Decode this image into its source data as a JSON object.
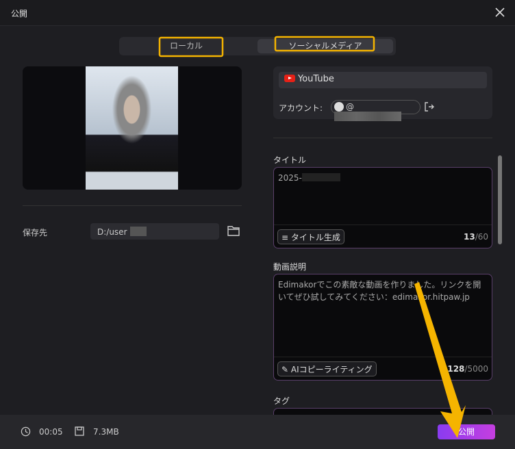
{
  "window": {
    "title": "公開"
  },
  "tabs": [
    {
      "label": "ローカル"
    },
    {
      "label": "ソーシャルメディア"
    }
  ],
  "save": {
    "label": "保存先",
    "path": "D:/user"
  },
  "platform": {
    "name": "YouTube",
    "account_label": "アカウント:",
    "account_prefix": "@"
  },
  "title_field": {
    "label": "タイトル",
    "value": "2025-",
    "generate_label": "タイトル生成",
    "count": "13",
    "max": "/60"
  },
  "description_field": {
    "label": "動画説明",
    "value": "Edimakorでこの素敵な動画を作りました。リンクを開いてぜひ試してみてください：edimakor.hitpaw.jp",
    "ai_label": "AIコピーライティング",
    "count": "128",
    "max": "/5000"
  },
  "tag_field": {
    "label": "タグ"
  },
  "footer": {
    "duration": "00:05",
    "size": "7.3MB",
    "publish_label": "公開"
  },
  "colors": {
    "accent": "#8a3cf0",
    "annotation": "#f5b400"
  }
}
